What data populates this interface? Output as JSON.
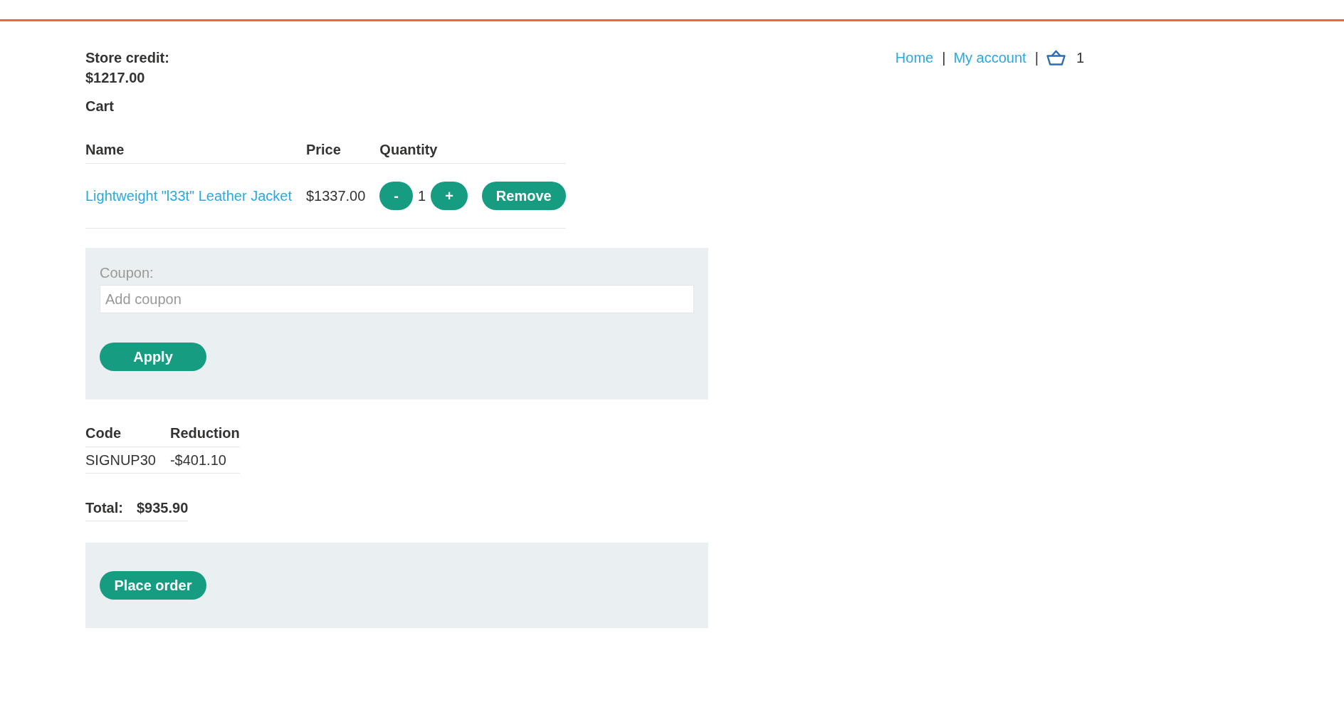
{
  "header": {
    "store_credit": {
      "label": "Store credit:",
      "amount": "$1217.00"
    },
    "nav": [
      {
        "kind": "link",
        "label": "Home"
      },
      {
        "kind": "separator",
        "label": "|"
      },
      {
        "kind": "link",
        "label": "My account"
      },
      {
        "kind": "separator",
        "label": "|"
      },
      {
        "kind": "cart",
        "count": "1"
      }
    ]
  },
  "cart": {
    "title": "Cart",
    "columns": [
      "Name",
      "Price",
      "Quantity"
    ],
    "rows": [
      {
        "name": "Lightweight \"l33t\" Leather Jacket",
        "price": "$1337.00",
        "decrease": "-",
        "quantity": "1",
        "increase": "+",
        "remove": "Remove"
      }
    ]
  },
  "coupon_form": {
    "label": "Coupon:",
    "placeholder": "Add coupon",
    "button": "Apply"
  },
  "coupons": {
    "columns": [
      "Code",
      "Reduction"
    ],
    "rows": [
      {
        "code": "SIGNUP30",
        "reduction": "-$401.10"
      }
    ]
  },
  "total": {
    "label": "Total:",
    "amount": "$935.90"
  },
  "order_form": {
    "button": "Place order"
  }
}
